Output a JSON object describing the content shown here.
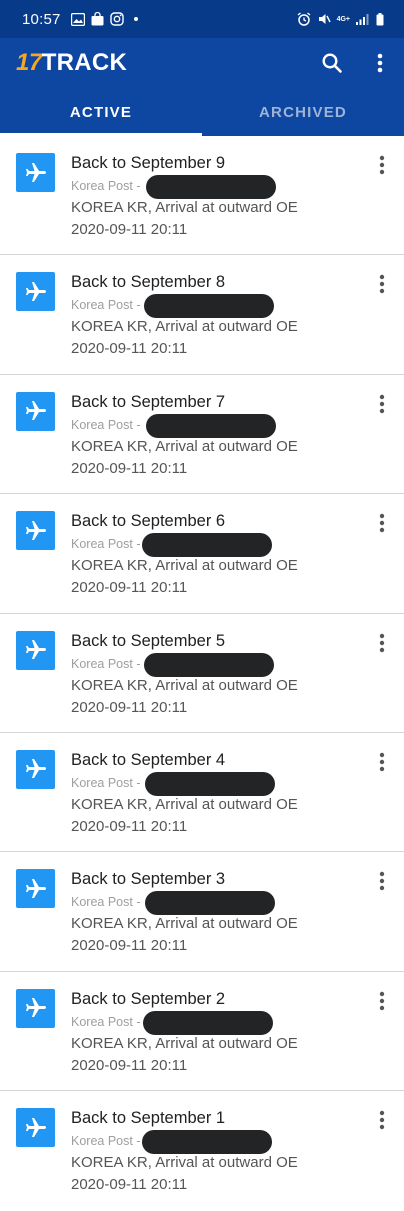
{
  "status_bar": {
    "time": "10:57",
    "network": "4G+"
  },
  "app": {
    "logo_number": "17",
    "logo_text": "TRACK",
    "colors": {
      "primary": "#0d47a1",
      "accent": "#f5a623",
      "icon_bg": "#2196f3"
    },
    "actions": [
      "search-icon",
      "more-vert-icon"
    ]
  },
  "tabs": [
    {
      "label": "ACTIVE",
      "selected": true
    },
    {
      "label": "ARCHIVED",
      "selected": false
    }
  ],
  "packages": [
    {
      "title": "Back to September 9",
      "carrier": "Korea Post -",
      "status": "KOREA KR, Arrival at outward OE",
      "date": "2020-09-11 20:11"
    },
    {
      "title": "Back to September 8",
      "carrier": "Korea Post -",
      "status": "KOREA KR, Arrival at outward OE",
      "date": "2020-09-11 20:11"
    },
    {
      "title": "Back to September 7",
      "carrier": "Korea Post -",
      "status": "KOREA KR, Arrival at outward OE",
      "date": "2020-09-11 20:11"
    },
    {
      "title": "Back to September 6",
      "carrier": "Korea Post -",
      "status": "KOREA KR, Arrival at outward OE",
      "date": "2020-09-11 20:11"
    },
    {
      "title": "Back to September 5",
      "carrier": "Korea Post -",
      "status": "KOREA KR, Arrival at outward OE",
      "date": "2020-09-11 20:11"
    },
    {
      "title": "Back to September 4",
      "carrier": "Korea Post -",
      "status": "KOREA KR, Arrival at outward OE",
      "date": "2020-09-11 20:11"
    },
    {
      "title": "Back to September 3",
      "carrier": "Korea Post -",
      "status": "KOREA KR, Arrival at outward OE",
      "date": "2020-09-11 20:11"
    },
    {
      "title": "Back to September 2",
      "carrier": "Korea Post -",
      "status": "KOREA KR, Arrival at outward OE",
      "date": "2020-09-11 20:11"
    },
    {
      "title": "Back to September 1",
      "carrier": "Korea Post -",
      "status": "KOREA KR, Arrival at outward OE",
      "date": "2020-09-11 20:11"
    }
  ]
}
